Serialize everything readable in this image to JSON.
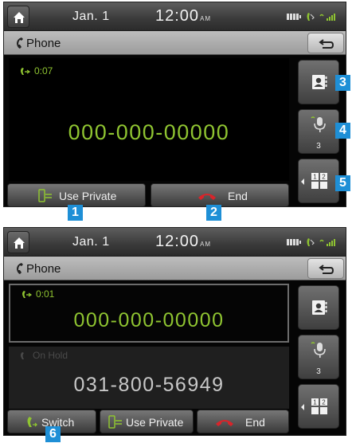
{
  "statusbar": {
    "date": "Jan.  1",
    "time": "12:00",
    "ampm": "AM"
  },
  "title": "Phone",
  "screen1": {
    "call_time": "0:07",
    "number": "000-000-00000",
    "buttons": {
      "use_private": "Use Private",
      "end": "End"
    },
    "dtmf_count": "3"
  },
  "screen2": {
    "active_call_time": "0:01",
    "active_number": "000-000-00000",
    "held_status": "On Hold",
    "held_number": "031-800-56949",
    "dtmf_count": "3",
    "buttons": {
      "switch": "Switch",
      "use_private": "Use Private",
      "end": "End"
    }
  },
  "callouts": [
    "1",
    "2",
    "3",
    "4",
    "5",
    "6"
  ],
  "colors": {
    "accent_green": "#8fc431",
    "end_red": "#d8242a",
    "callout_blue": "#1e8fd6"
  },
  "icons": [
    "home-icon",
    "battery-icon",
    "bluetooth-phone-icon",
    "signal-icon",
    "phone-icon",
    "back-arrow-icon",
    "contacts-icon",
    "mic-mute-icon",
    "keypad-icon",
    "phone-transfer-icon",
    "end-call-icon",
    "switch-call-icon"
  ]
}
